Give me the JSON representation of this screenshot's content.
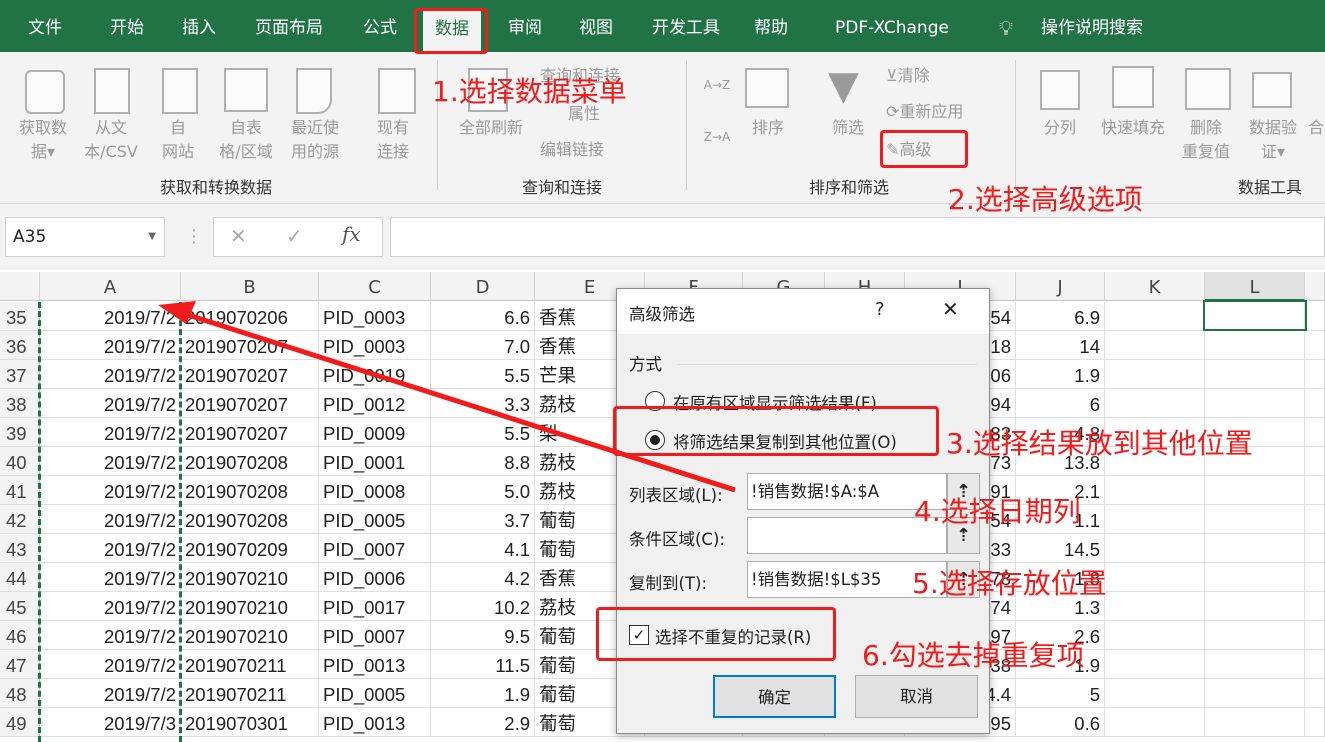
{
  "menu": {
    "tabs": [
      "文件",
      "开始",
      "插入",
      "页面布局",
      "公式",
      "数据",
      "审阅",
      "视图",
      "开发工具",
      "帮助",
      "PDF-XChange"
    ],
    "active": "数据",
    "search": "操作说明搜索"
  },
  "ribbon": {
    "get_data": {
      "items": [
        "获取数\n据▾",
        "从文\n本/CSV",
        "自\n网站",
        "自表\n格/区域",
        "最近使\n用的源",
        "现有\n连接"
      ],
      "label": "获取和转换数据"
    },
    "queries": {
      "refresh_all": "全部刷新",
      "queries_connections": "查询和连接",
      "properties": "属性",
      "edit_links": "编辑链接",
      "label": "查询和连接"
    },
    "sort_filter": {
      "sort_az": "A→Z",
      "sort_za": "Z→A",
      "sort": "排序",
      "filter": "筛选",
      "clear": "清除",
      "reapply": "重新应用",
      "advanced": "高级",
      "label": "排序和筛选"
    },
    "data_tools": {
      "items": [
        "分列",
        "快速填充",
        "删除\n重复值",
        "数据验\n证▾",
        "合"
      ],
      "label": "数据工具"
    }
  },
  "formula_bar": {
    "name_box": "A35",
    "cancel": "✕",
    "enter": "✓",
    "fx": "fx",
    "value": ""
  },
  "sheet": {
    "columns": [
      "A",
      "B",
      "C",
      "D",
      "E",
      "F",
      "G",
      "H",
      "I",
      "J",
      "K",
      "L"
    ],
    "selected_column": "L",
    "rows": [
      {
        "n": "35",
        "A": "2019/7/2",
        "B": "2019070206",
        "C": "PID_0003",
        "D": "6.6",
        "E": "香蕉",
        "I": "54",
        "J": "6.9"
      },
      {
        "n": "36",
        "A": "2019/7/2",
        "B": "2019070207",
        "C": "PID_0003",
        "D": "7.0",
        "E": "香蕉",
        "I": "18",
        "J": "14"
      },
      {
        "n": "37",
        "A": "2019/7/2",
        "B": "2019070207",
        "C": "PID_0019",
        "D": "5.5",
        "E": "芒果",
        "I": "06",
        "J": "1.9"
      },
      {
        "n": "38",
        "A": "2019/7/2",
        "B": "2019070207",
        "C": "PID_0012",
        "D": "3.3",
        "E": "荔枝",
        "I": "94",
        "J": "6"
      },
      {
        "n": "39",
        "A": "2019/7/2",
        "B": "2019070207",
        "C": "PID_0009",
        "D": "5.5",
        "E": "梨",
        "I": "83",
        "J": "4.8"
      },
      {
        "n": "40",
        "A": "2019/7/2",
        "B": "2019070208",
        "C": "PID_0001",
        "D": "8.8",
        "E": "荔枝",
        "I": "73",
        "J": "13.8"
      },
      {
        "n": "41",
        "A": "2019/7/2",
        "B": "2019070208",
        "C": "PID_0008",
        "D": "5.0",
        "E": "荔枝",
        "I": "91",
        "J": "2.1"
      },
      {
        "n": "42",
        "A": "2019/7/2",
        "B": "2019070208",
        "C": "PID_0005",
        "D": "3.7",
        "E": "葡萄",
        "I": "54",
        "J": "1.1"
      },
      {
        "n": "43",
        "A": "2019/7/2",
        "B": "2019070209",
        "C": "PID_0007",
        "D": "4.1",
        "E": "葡萄",
        "I": "33",
        "J": "14.5"
      },
      {
        "n": "44",
        "A": "2019/7/2",
        "B": "2019070210",
        "C": "PID_0006",
        "D": "4.2",
        "E": "香蕉",
        "I": "78",
        "J": "1.8"
      },
      {
        "n": "45",
        "A": "2019/7/2",
        "B": "2019070210",
        "C": "PID_0017",
        "D": "10.2",
        "E": "荔枝",
        "I": "74",
        "J": "1.3"
      },
      {
        "n": "46",
        "A": "2019/7/2",
        "B": "2019070210",
        "C": "PID_0007",
        "D": "9.5",
        "E": "葡萄",
        "I": "97",
        "J": "2.6"
      },
      {
        "n": "47",
        "A": "2019/7/2",
        "B": "2019070211",
        "C": "PID_0013",
        "D": "11.5",
        "E": "葡萄",
        "I": "38",
        "J": "1.9"
      },
      {
        "n": "48",
        "A": "2019/7/2",
        "B": "2019070211",
        "C": "PID_0005",
        "D": "1.9",
        "E": "葡萄",
        "I": "4.4",
        "J": "5"
      },
      {
        "n": "49",
        "A": "2019/7/3",
        "B": "2019070301",
        "C": "PID_0013",
        "D": "2.9",
        "E": "葡萄",
        "I": "95",
        "J": "0.6"
      }
    ]
  },
  "dialog": {
    "title": "高级筛选",
    "help": "?",
    "close": "✕",
    "method_label": "方式",
    "option_in_place": "在原有区域显示筛选结果(F)",
    "option_copy": "将筛选结果复制到其他位置(O)",
    "selected_option": "copy",
    "list_range_label": "列表区域(L):",
    "list_range_value": "!销售数据!$A:$A",
    "criteria_label": "条件区域(C):",
    "criteria_value": "",
    "copy_to_label": "复制到(T):",
    "copy_to_value": "!销售数据!$L$35",
    "unique_label": "选择不重复的记录(R)",
    "unique_checked": true,
    "ok": "确定",
    "cancel": "取消"
  },
  "annotations": [
    "1.选择数据菜单",
    "2.选择高级选项",
    "3.选择结果放到其他位置",
    "4.选择日期列",
    "5.选择存放位置",
    "6.勾选去掉重复项"
  ],
  "colors": {
    "excel_green": "#217346",
    "annotation_red": "#f21b1b"
  }
}
